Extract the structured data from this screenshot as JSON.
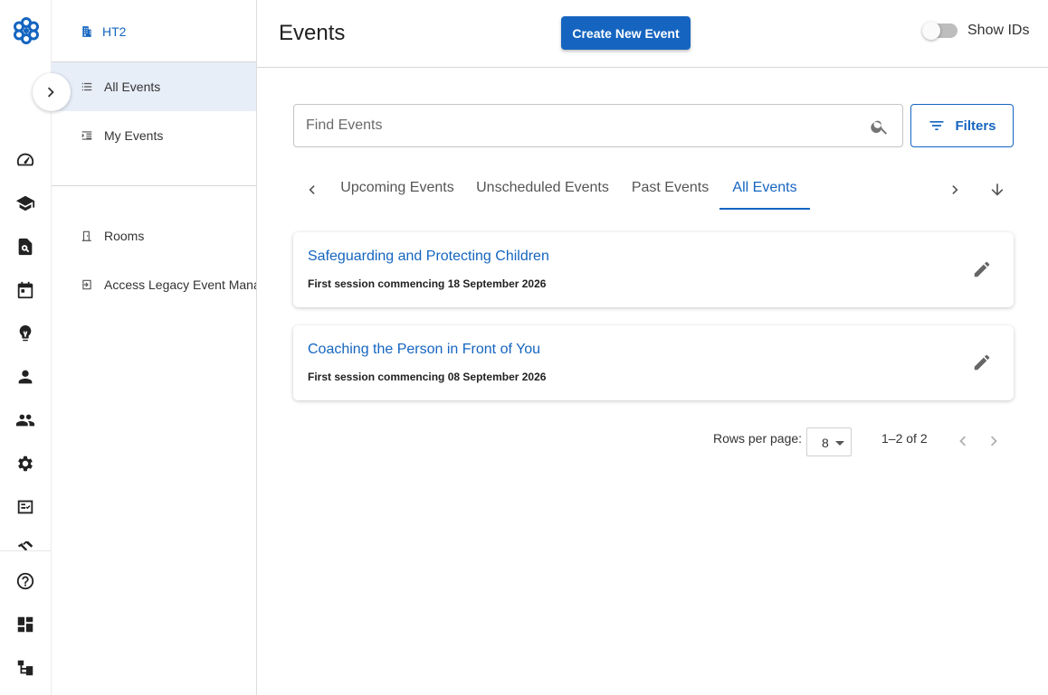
{
  "rail": {
    "icons": [
      "dashboard-speed-icon",
      "school-icon",
      "document-search-icon",
      "calendar-icon",
      "lightbulb-icon",
      "person-icon",
      "people-icon",
      "settings-icon",
      "checklist-icon",
      "handshake-icon",
      "help-icon",
      "layout-icon",
      "hierarchy-icon"
    ]
  },
  "subnav": {
    "org": "HT2",
    "items": [
      {
        "label": "All Events",
        "active": true
      },
      {
        "label": "My Events",
        "active": false
      },
      {
        "label": "Rooms",
        "active": false
      },
      {
        "label": "Access Legacy Event Management",
        "active": false
      }
    ]
  },
  "header": {
    "title": "Events",
    "create_button": "Create New Event",
    "toggle_label": "Show IDs",
    "toggle_on": false
  },
  "search": {
    "placeholder": "Find Events",
    "value": ""
  },
  "filters": {
    "label": "Filters"
  },
  "tabs": [
    {
      "label": "Upcoming Events",
      "active": false
    },
    {
      "label": "Unscheduled Events",
      "active": false
    },
    {
      "label": "Past Events",
      "active": false
    },
    {
      "label": "All Events",
      "active": true
    }
  ],
  "events": [
    {
      "title": "Safeguarding and Protecting Children",
      "subtitle": "First session commencing 18 September 2026"
    },
    {
      "title": "Coaching the Person in Front of You",
      "subtitle": "First session commencing 08 September 2026"
    }
  ],
  "pagination": {
    "rows_label": "Rows per page:",
    "rows_value": "8",
    "range": "1–2 of 2"
  },
  "colors": {
    "accent": "#1565c0",
    "active_nav_bg": "#e8eef8"
  }
}
